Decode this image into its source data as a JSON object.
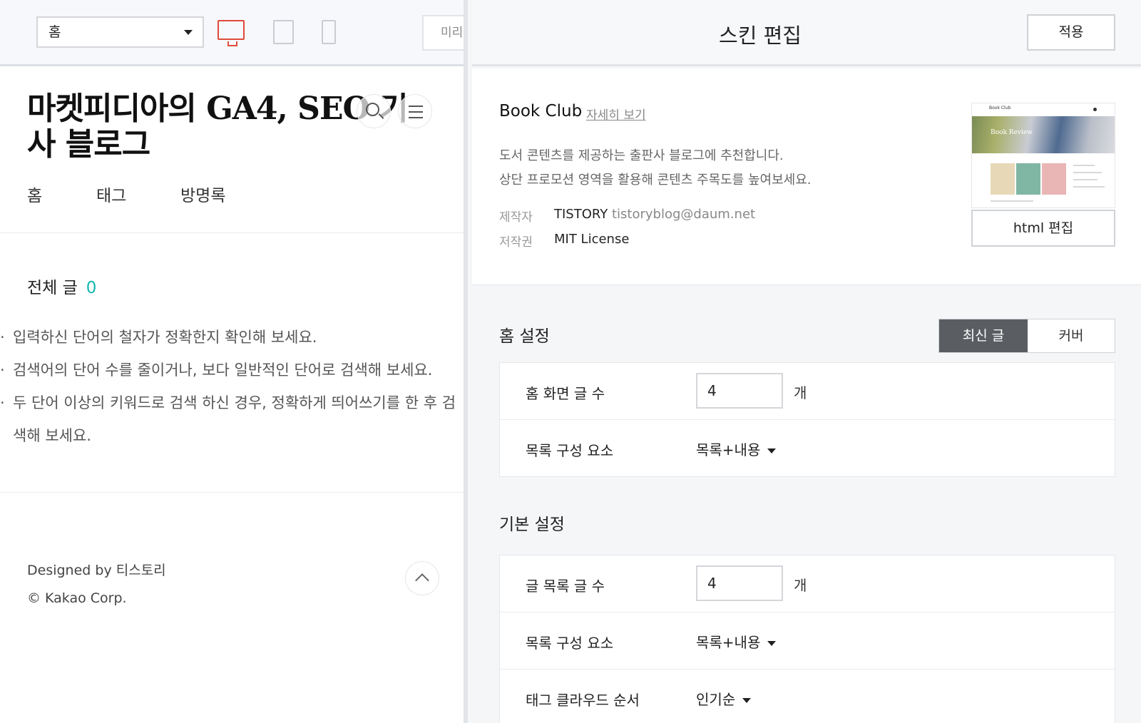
{
  "preview_toolbar": {
    "page_select": "홈",
    "preview_label": "미리보기"
  },
  "blog": {
    "title": "마켓피디아의 GA4, SEO 기사 블로그",
    "nav": [
      "홈",
      "태그",
      "방명록"
    ],
    "total_label": "전체 글",
    "total_count": "0",
    "tips": [
      "입력하신 단어의 철자가 정확한지 확인해 보세요.",
      "검색어의 단어 수를 줄이거나, 보다 일반적인 단어로 검색해 보세요.",
      "두 단어 이상의 키워드로 검색 하신 경우, 정확하게 띄어쓰기를 한 후 검색해 보세요."
    ],
    "designed_by": "Designed by 티스토리",
    "copyright": "© Kakao Corp."
  },
  "editor": {
    "title": "스킨 편집",
    "apply": "적용",
    "skin": {
      "name": "Book Club",
      "more": "자세히 보기",
      "desc1": "도서 콘텐츠를 제공하는 출판사 블로그에 추천합니다.",
      "desc2": "상단 프로모션 영역을 활용해 콘텐츠 주목도를 높여보세요.",
      "maker_label": "제작자",
      "maker": "TISTORY",
      "email": "tistoryblog@daum.net",
      "license_label": "저작권",
      "license": "MIT License",
      "thumb_brand": "Book Club",
      "thumb_banner": "Book Review",
      "html_edit": "html 편집"
    },
    "home": {
      "title": "홈 설정",
      "seg_latest": "최신 글",
      "seg_cover": "커버",
      "post_count_label": "홈 화면 글 수",
      "post_count": "4",
      "unit": "개",
      "list_label": "목록 구성 요소",
      "list_value": "목록+내용"
    },
    "basic": {
      "title": "기본 설정",
      "post_count_label": "글 목록 글 수",
      "post_count": "4",
      "unit": "개",
      "list_label": "목록 구성 요소",
      "list_value": "목록+내용",
      "tag_label": "태그 클라우드 순서",
      "tag_value": "인기순"
    }
  },
  "colors": {
    "accent_teal": "#14b8b0",
    "device_active": "#e04a3a",
    "segment_active": "#5a5d62"
  }
}
